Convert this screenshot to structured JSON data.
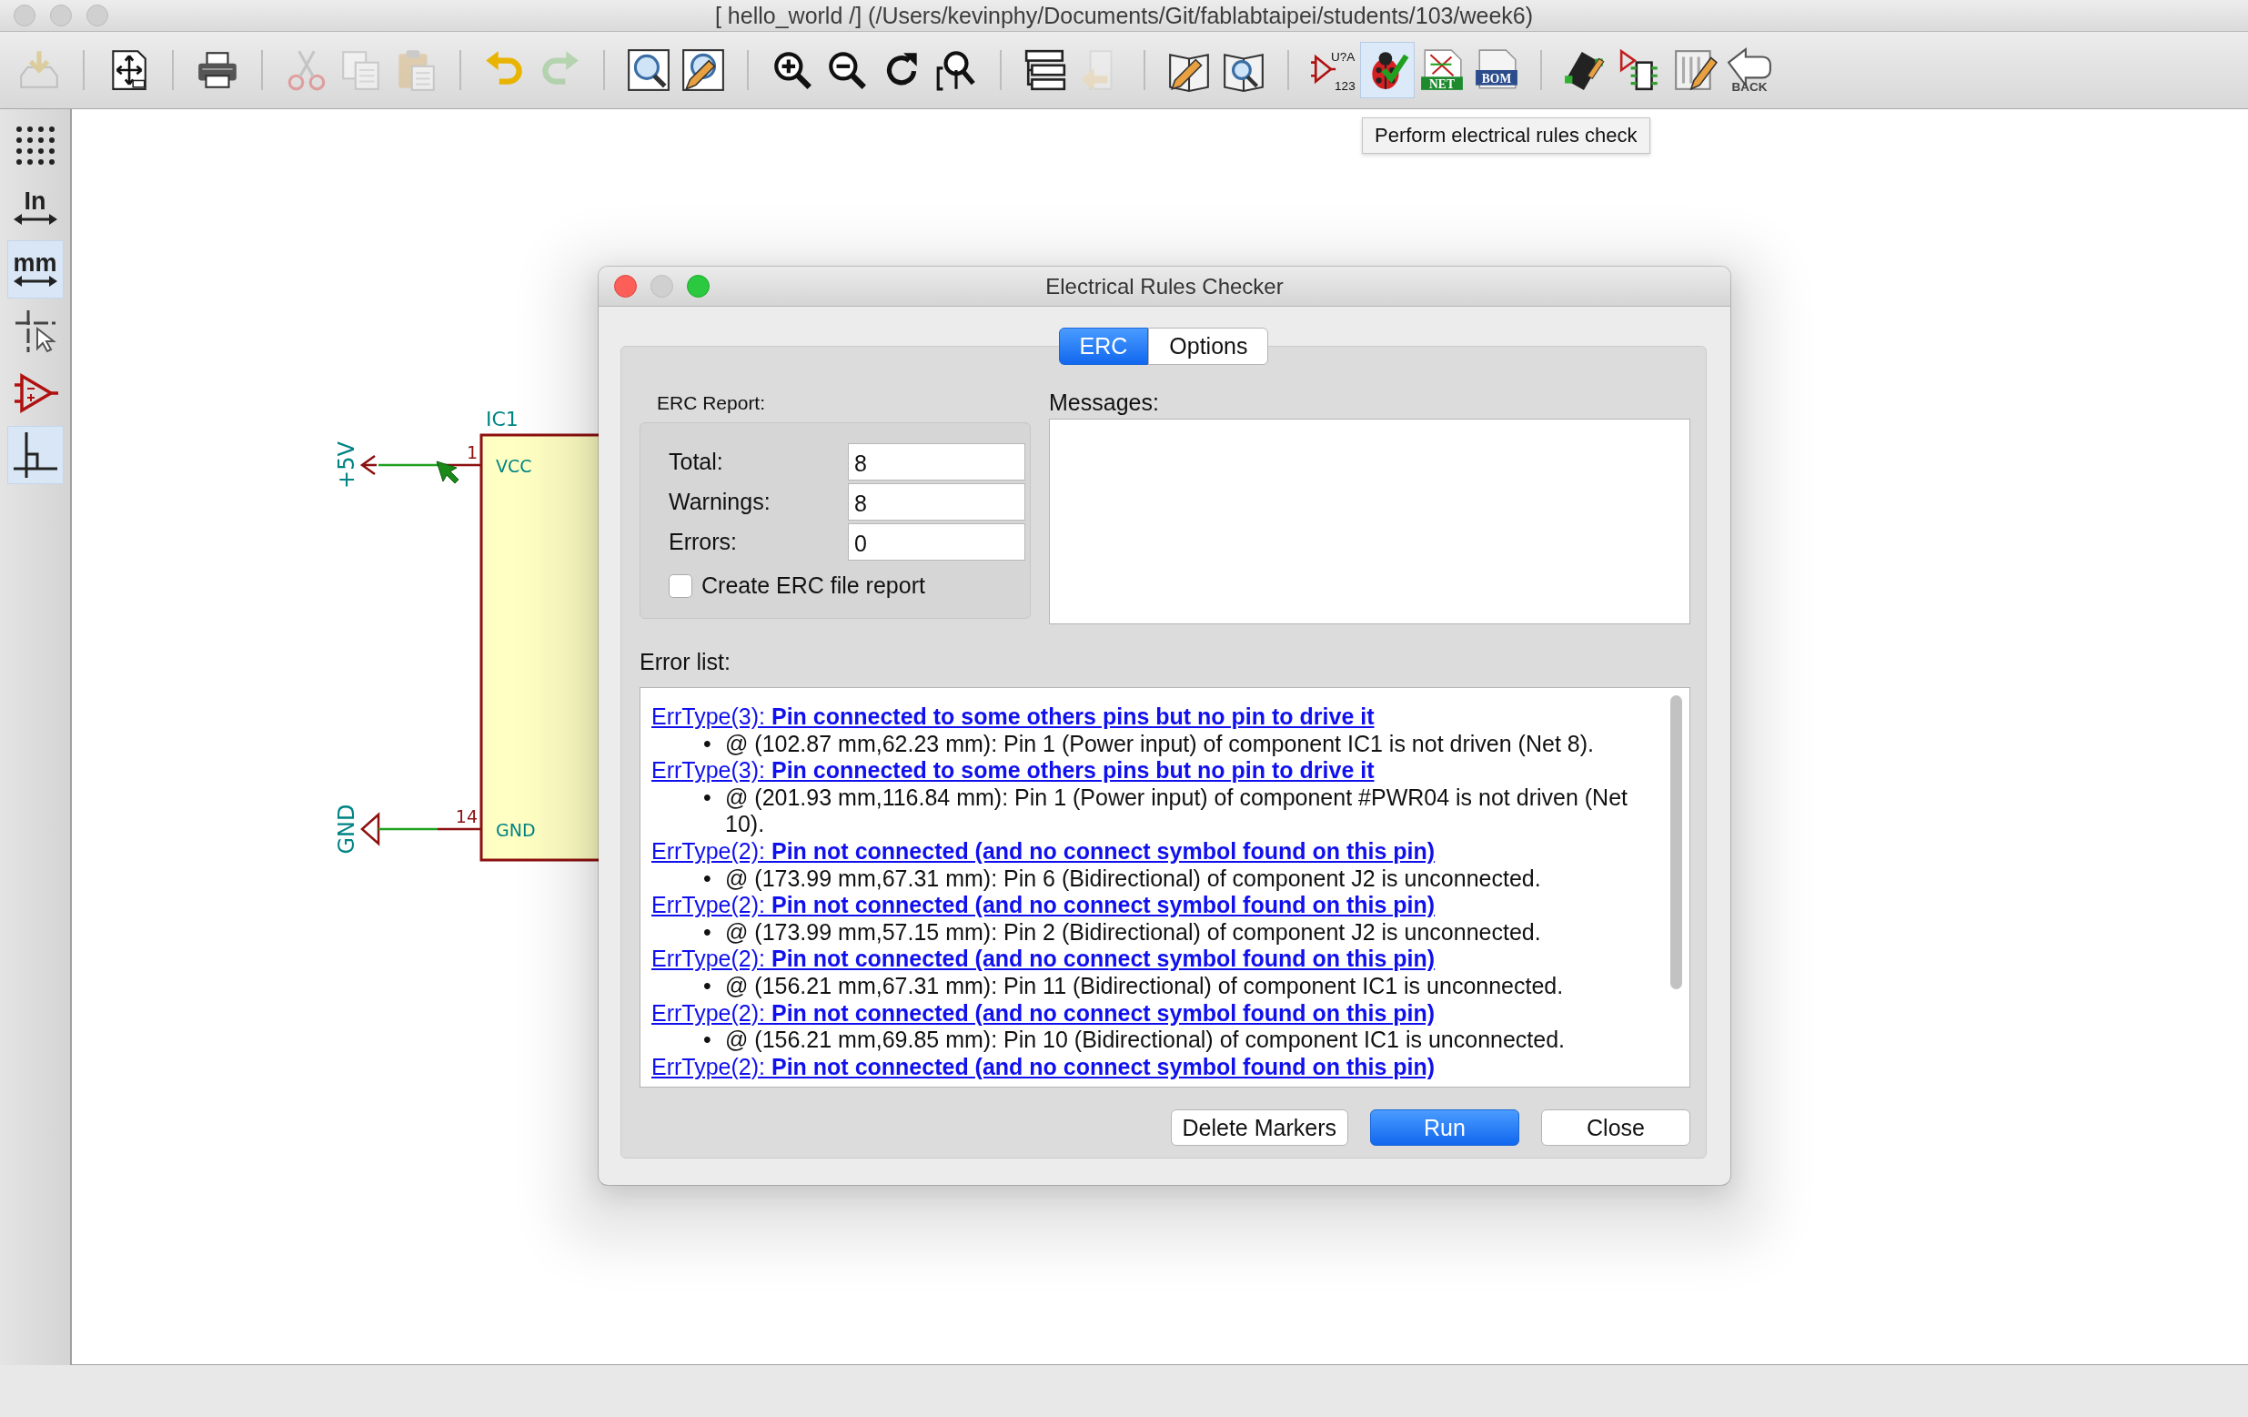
{
  "window": {
    "title": "[ hello_world /] (/Users/kevinphy/Documents/Git/fablabtaipei/students/103/week6)"
  },
  "toolbar": [
    {
      "disabled": true,
      "highlighted": false
    },
    {
      "disabled": false,
      "highlighted": false
    },
    {
      "disabled": false,
      "highlighted": false
    },
    {
      "disabled": true,
      "highlighted": false
    },
    {
      "disabled": true,
      "highlighted": false
    },
    {
      "disabled": true,
      "highlighted": false
    },
    {
      "disabled": false,
      "highlighted": false
    },
    {
      "disabled": true,
      "highlighted": false
    },
    {
      "disabled": false,
      "highlighted": false
    },
    {
      "disabled": false,
      "highlighted": false
    },
    {
      "disabled": false,
      "highlighted": false
    },
    {
      "disabled": false,
      "highlighted": false
    },
    {
      "disabled": false,
      "highlighted": false
    },
    {
      "disabled": false,
      "highlighted": false
    },
    {
      "disabled": false,
      "highlighted": false
    },
    {
      "disabled": true,
      "highlighted": false
    },
    {
      "disabled": false,
      "highlighted": false
    },
    {
      "disabled": false,
      "highlighted": false
    },
    {
      "disabled": false,
      "highlighted": false,
      "label": "U?A",
      "sublabel": "123"
    },
    {
      "disabled": false,
      "highlighted": true
    },
    {
      "disabled": false,
      "highlighted": false,
      "label": "NET"
    },
    {
      "disabled": false,
      "highlighted": false,
      "label": "BOM"
    },
    {
      "disabled": false,
      "highlighted": false
    },
    {
      "disabled": false,
      "highlighted": false
    },
    {
      "disabled": false,
      "highlighted": false
    },
    {
      "disabled": false,
      "highlighted": false,
      "label": "BACK"
    }
  ],
  "tooltip": {
    "text": "Perform electrical rules check"
  },
  "left_toolbar": [
    {
      "selected": false
    },
    {
      "label": "In",
      "selected": false
    },
    {
      "label": "mm",
      "selected": true
    },
    {
      "selected": false
    },
    {
      "selected": false
    },
    {
      "selected": true
    }
  ],
  "schematic": {
    "reference": "IC1",
    "pins": [
      {
        "number": "1",
        "name": "VCC",
        "net": "+5V",
        "kind": "power"
      },
      {
        "number": "14",
        "name": "GND",
        "net": "GND",
        "kind": "ground"
      }
    ]
  },
  "dialog": {
    "title": "Electrical Rules Checker",
    "tabs": [
      {
        "label": "ERC",
        "selected": true
      },
      {
        "label": "Options",
        "selected": false
      }
    ],
    "report": {
      "title": "ERC Report:",
      "fields": [
        {
          "label": "Total:",
          "value": "8"
        },
        {
          "label": "Warnings:",
          "value": "8"
        },
        {
          "label": "Errors:",
          "value": "0"
        }
      ],
      "create_file_report": {
        "label": "Create ERC file report",
        "checked": false
      }
    },
    "messages": {
      "label": "Messages:"
    },
    "error_list": {
      "label": "Error list:",
      "items": [
        {
          "heading": "ErrType(3): **Pin connected to some others pins but no pin to drive it**",
          "bullet": "•",
          "detail": "@ (102.87 mm,62.23 mm): Pin 1 (Power input) of component IC1 is not driven (Net 8)."
        },
        {
          "heading": "ErrType(3): **Pin connected to some others pins but no pin to drive it**",
          "bullet": "•",
          "detail": "@ (201.93 mm,116.84 mm): Pin 1 (Power input) of component #PWR04 is not driven (Net 10)."
        },
        {
          "heading": "ErrType(2): **Pin not connected (and no connect symbol found on this pin)**",
          "bullet": "•",
          "detail": "@ (173.99 mm,67.31 mm): Pin 6 (Bidirectional) of component J2 is unconnected."
        },
        {
          "heading": "ErrType(2): **Pin not connected (and no connect symbol found on this pin)**",
          "bullet": "•",
          "detail": "@ (173.99 mm,57.15 mm): Pin 2 (Bidirectional) of component J2 is unconnected."
        },
        {
          "heading": "ErrType(2): **Pin not connected (and no connect symbol found on this pin)**",
          "bullet": "•",
          "detail": "@ (156.21 mm,67.31 mm): Pin 11 (Bidirectional) of component IC1 is unconnected."
        },
        {
          "heading": "ErrType(2): **Pin not connected (and no connect symbol found on this pin)**",
          "bullet": "•",
          "detail": "@ (156.21 mm,69.85 mm): Pin 10 (Bidirectional) of component IC1 is unconnected."
        },
        {
          "heading": "ErrType(2): **Pin not connected (and no connect symbol found on this pin)**"
        }
      ]
    },
    "buttons": [
      {
        "label": "Delete Markers",
        "kind": "default"
      },
      {
        "label": "Run",
        "kind": "primary"
      },
      {
        "label": "Close",
        "kind": "default"
      }
    ]
  }
}
